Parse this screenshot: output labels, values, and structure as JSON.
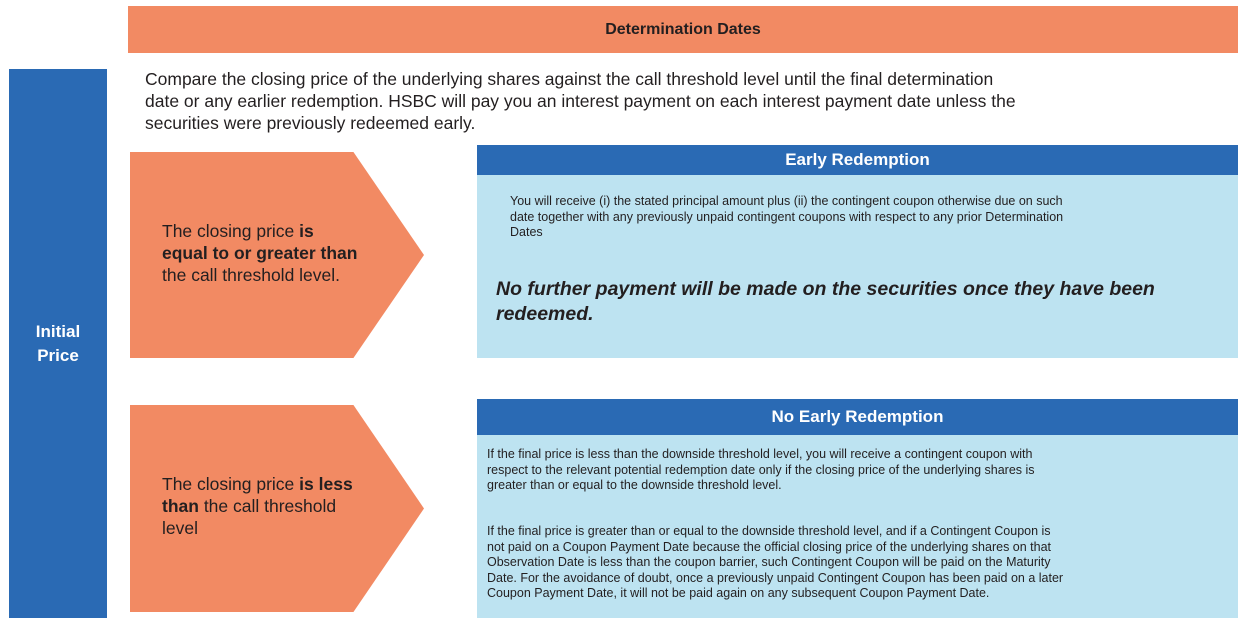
{
  "header": {
    "title": "Determination Dates"
  },
  "side": {
    "label_line1": "Initial",
    "label_line2": "Price"
  },
  "intro": {
    "line1": "Compare the closing price of the underlying shares against the call threshold level until the final determination",
    "line2": "date or any earlier redemption. HSBC will pay you an interest payment on each interest payment date unless the",
    "line3": "securities were previously redeemed early."
  },
  "condition_equal": {
    "line1": "The closing price ",
    "line1_bold": "is",
    "line2_bold": "equal to or greater than",
    "line3": "the call threshold level."
  },
  "condition_less": {
    "line1": "The closing price ",
    "line1_bold": "is less",
    "line2_bold": "than",
    "line2": " the call threshold",
    "line3": "level"
  },
  "early_redemption": {
    "title": "Early Redemption",
    "line1": "You will receive (i) the stated principal amount plus (ii) the contingent coupon otherwise due on such",
    "line2": "date together with any previously unpaid contingent coupons with respect to any prior Determination",
    "line3": "Dates",
    "emphasis_line1": "No further payment will be made on the securities once they have been",
    "emphasis_line2": "redeemed."
  },
  "no_early_redemption": {
    "title": "No Early Redemption",
    "p1_line1": "If the final price is less than the downside threshold level, you will receive a contingent coupon with",
    "p1_line2": "respect to the relevant potential redemption date only if the closing price of the underlying shares is",
    "p1_line3": "greater than or equal to the downside threshold level.",
    "p2_line1": "If the final price is greater than or equal to the downside threshold level, and if a Contingent Coupon is",
    "p2_line2": "not paid on a Coupon Payment Date because the official closing price of the underlying shares on that",
    "p2_line3": "Observation Date is less than the coupon barrier, such Contingent Coupon will be paid on the Maturity",
    "p2_line4": "Date. For the avoidance of doubt, once a previously unpaid Contingent Coupon has been paid on a later",
    "p2_line5": "Coupon Payment Date, it will not be paid again on any subsequent Coupon Payment Date."
  },
  "colors": {
    "orange": "#f28a63",
    "blue": "#2a6ab4",
    "light_blue": "#bde3f1",
    "text": "#231f20"
  }
}
